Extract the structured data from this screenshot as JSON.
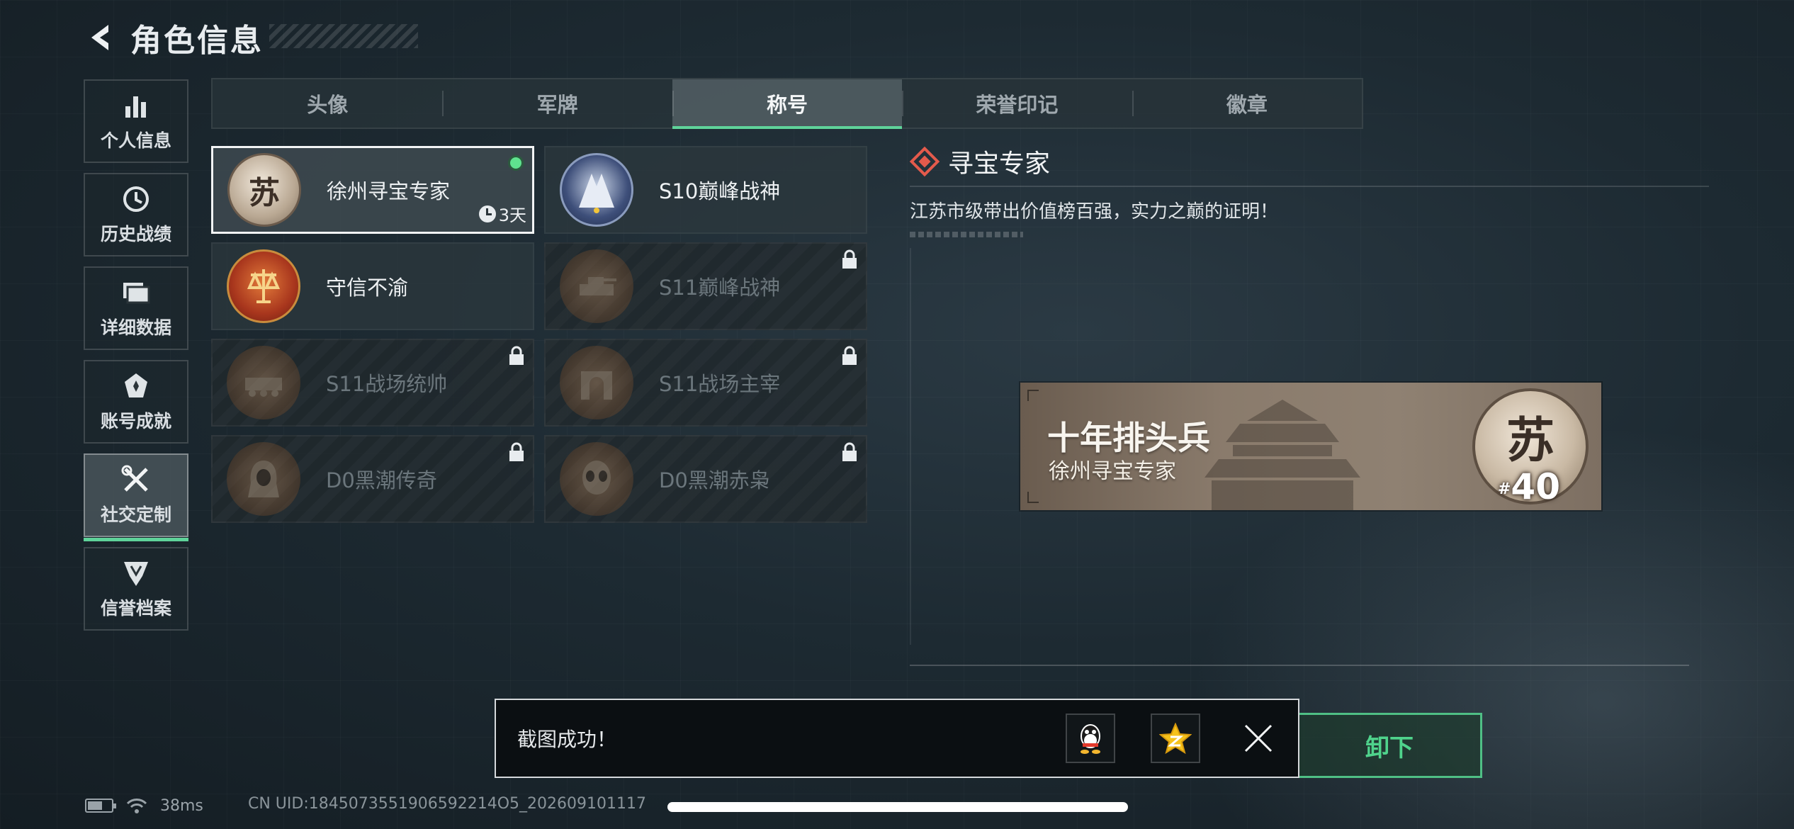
{
  "header": {
    "title": "角色信息"
  },
  "sidebar": {
    "items": [
      {
        "label": "个人信息",
        "icon": "bar-chart-icon",
        "active": false
      },
      {
        "label": "历史战绩",
        "icon": "history-clock-icon",
        "active": false
      },
      {
        "label": "详细数据",
        "icon": "folder-icon",
        "active": false
      },
      {
        "label": "账号成就",
        "icon": "achievement-icon",
        "active": false
      },
      {
        "label": "社交定制",
        "icon": "tools-icon",
        "active": true
      },
      {
        "label": "信誉档案",
        "icon": "credit-shield-icon",
        "active": false
      }
    ]
  },
  "tabs": [
    {
      "label": "头像",
      "active": false
    },
    {
      "label": "军牌",
      "active": false
    },
    {
      "label": "称号",
      "active": true
    },
    {
      "label": "荣誉印记",
      "active": false
    },
    {
      "label": "徽章",
      "active": false
    }
  ],
  "titles": [
    {
      "name": "徐州寻宝专家",
      "glyph": "苏",
      "state": "selected",
      "equipped": true,
      "timer": "3天"
    },
    {
      "name": "S10巅峰战神",
      "glyph": "",
      "state": "unlocked"
    },
    {
      "name": "守信不渝",
      "glyph": "",
      "state": "unlocked"
    },
    {
      "name": "S11巅峰战神",
      "glyph": "",
      "state": "locked"
    },
    {
      "name": "S11战场统帅",
      "glyph": "",
      "state": "locked"
    },
    {
      "name": "S11战场主宰",
      "glyph": "",
      "state": "locked"
    },
    {
      "name": "D0黑潮传奇",
      "glyph": "",
      "state": "locked"
    },
    {
      "name": "D0黑潮赤枭",
      "glyph": "",
      "state": "locked"
    }
  ],
  "detail": {
    "title": "寻宝专家",
    "description": "江苏市级带出价值榜百强，实力之巅的证明！"
  },
  "preview": {
    "main_text": "十年排头兵",
    "sub_text": "徐州寻宝专家",
    "medal_glyph": "苏",
    "rank_hash": "#",
    "rank": "40"
  },
  "action": {
    "unequip_label": "卸下"
  },
  "toast": {
    "message": "截图成功！"
  },
  "status": {
    "ping": "38ms",
    "uid": "CN UID:1845073551906592214O5_202609101117"
  },
  "colors": {
    "accent": "#5fd39a",
    "danger": "#e45a4c",
    "plate": "#8a7b6c"
  }
}
